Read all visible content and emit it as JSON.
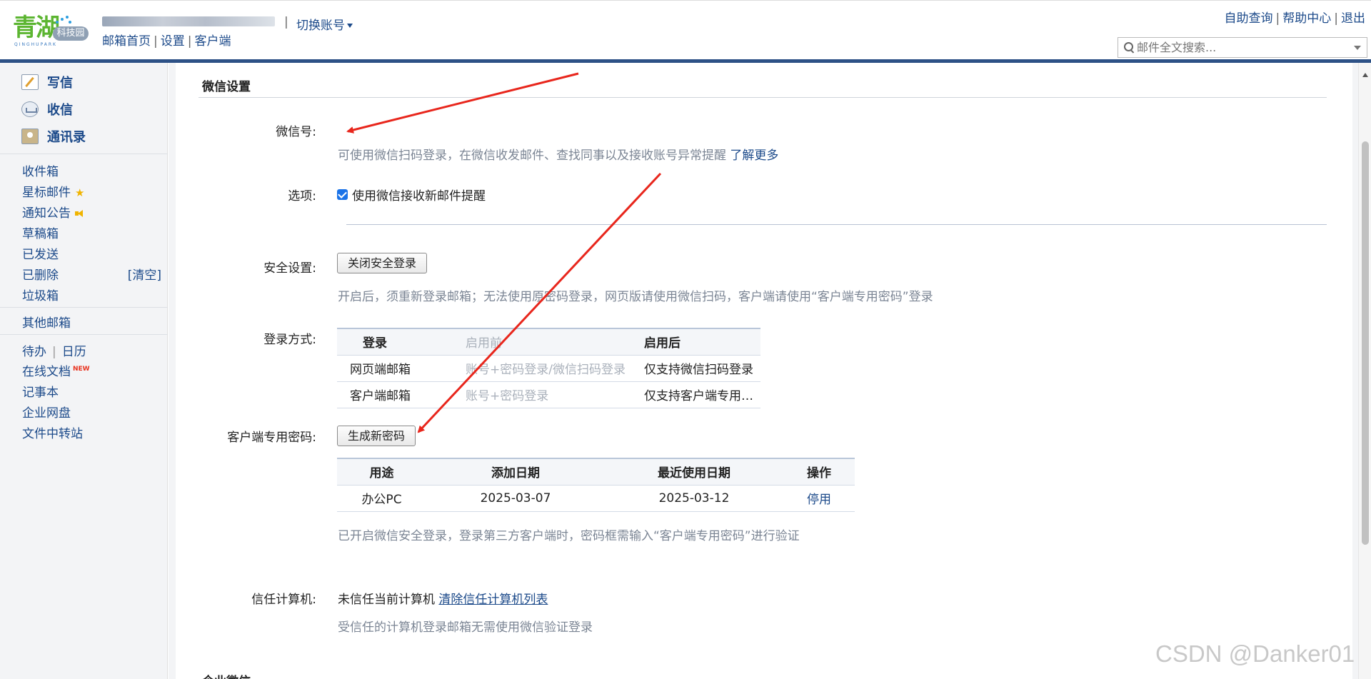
{
  "header": {
    "logo_text": "青湖",
    "logo_badge": "科技园",
    "logo_sub": "QINGHUPARK",
    "account_separator": "|",
    "switch_account": "切换账号",
    "nav": [
      "邮箱首页",
      "设置",
      "客户端"
    ],
    "top_links": [
      "自助查询",
      "帮助中心",
      "退出"
    ],
    "search_placeholder": "邮件全文搜索..."
  },
  "sidebar": {
    "compose": "写信",
    "inbox": "收信",
    "contacts": "通讯录",
    "folders": [
      "收件箱",
      "星标邮件",
      "通知公告",
      "草稿箱",
      "已发送",
      "已删除",
      "垃圾箱"
    ],
    "clear_label": "[清空]",
    "other_mail": "其他邮箱",
    "todo": "待办",
    "calendar": "日历",
    "tools": [
      "在线文档",
      "记事本",
      "企业网盘",
      "文件中转站"
    ],
    "new_badge": "NEW"
  },
  "settings": {
    "section_title": "微信设置",
    "wechat_label": "微信号:",
    "wechat_desc": "可使用微信扫码登录，在微信收发邮件、查找同事以及接收账号异常提醒",
    "learn_more": "了解更多",
    "options_label": "选项:",
    "options_checkbox": "使用微信接收新邮件提醒",
    "options_checked": true,
    "security_label": "安全设置:",
    "security_button": "关闭安全登录",
    "security_desc": "开启后，须重新登录邮箱；无法使用原密码登录，网页版请使用微信扫码，客户端请使用“客户端专用密码”登录",
    "login_label": "登录方式:",
    "login_table": {
      "headers": [
        "登录",
        "启用前",
        "启用后"
      ],
      "rows": [
        [
          "网页端邮箱",
          "账号+密码登录/微信扫码登录",
          "仅支持微信扫码登录"
        ],
        [
          "客户端邮箱",
          "账号+密码登录",
          "仅支持客户端专用…"
        ]
      ]
    },
    "client_pw_label": "客户端专用密码:",
    "client_pw_button": "生成新密码",
    "pw_table": {
      "headers": [
        "用途",
        "添加日期",
        "最近使用日期",
        "操作"
      ],
      "rows": [
        [
          "办公PC",
          "2025-03-07",
          "2025-03-12",
          "停用"
        ]
      ]
    },
    "pw_desc": "已开启微信安全登录，登录第三方客户端时，密码框需输入“客户端专用密码”进行验证",
    "trust_label": "信任计算机:",
    "trust_status": "未信任当前计算机",
    "trust_link": "清除信任计算机列表",
    "trust_desc": "受信任的计算机登录邮箱无需使用微信验证登录",
    "next_section": "企业微信"
  },
  "watermark": "CSDN @Danker01",
  "colors": {
    "accent": "#1c4a8a",
    "header_bar": "#2d5186",
    "arrow": "#e8261c"
  }
}
